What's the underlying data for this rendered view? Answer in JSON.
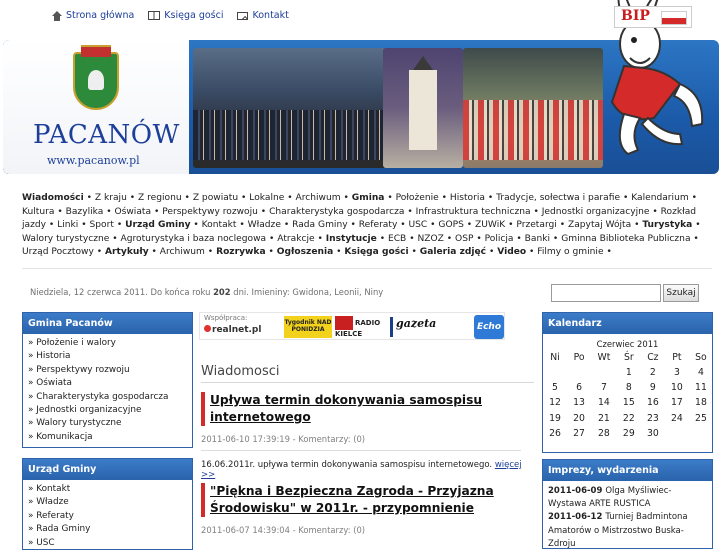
{
  "topnav": {
    "home": "Strona główna",
    "guestbook": "Księga gości",
    "contact": "Kontakt"
  },
  "brand": {
    "title": "PACANÓW",
    "url": "www.pacanow.pl",
    "bip_logo": "BIP"
  },
  "nav": [
    {
      "label": "Wiadomości",
      "bold": true
    },
    {
      "label": "Z kraju",
      "bold": false
    },
    {
      "label": "Z regionu",
      "bold": false
    },
    {
      "label": "Z powiatu",
      "bold": false
    },
    {
      "label": "Lokalne",
      "bold": false
    },
    {
      "label": "Archiwum",
      "bold": false
    },
    {
      "label": "Gmina",
      "bold": true
    },
    {
      "label": "Położenie",
      "bold": false
    },
    {
      "label": "Historia",
      "bold": false
    },
    {
      "label": "Tradycje, sołectwa i parafie",
      "bold": false
    },
    {
      "label": "Kalendarium",
      "bold": false
    },
    {
      "label": "Kultura",
      "bold": false
    },
    {
      "label": "Bazylika",
      "bold": false
    },
    {
      "label": "Oświata",
      "bold": false
    },
    {
      "label": "Perspektywy rozwoju",
      "bold": false
    },
    {
      "label": "Charakterystyka gospodarcza",
      "bold": false
    },
    {
      "label": "Infrastruktura techniczna",
      "bold": false
    },
    {
      "label": "Jednostki organizacyjne",
      "bold": false
    },
    {
      "label": "Rozkład jazdy",
      "bold": false
    },
    {
      "label": "Linki",
      "bold": false
    },
    {
      "label": "Sport",
      "bold": false
    },
    {
      "label": "Urząd Gminy",
      "bold": true
    },
    {
      "label": "Kontakt",
      "bold": false
    },
    {
      "label": "Władze",
      "bold": false
    },
    {
      "label": "Rada Gminy",
      "bold": false
    },
    {
      "label": "Referaty",
      "bold": false
    },
    {
      "label": "USC",
      "bold": false
    },
    {
      "label": "GOPS",
      "bold": false
    },
    {
      "label": "ZUWiK",
      "bold": false
    },
    {
      "label": "Przetargi",
      "bold": false
    },
    {
      "label": "Zapytaj Wójta",
      "bold": false
    },
    {
      "label": "Turystyka",
      "bold": true
    },
    {
      "label": "Walory turystyczne",
      "bold": false
    },
    {
      "label": "Agroturystyka i baza noclegowa",
      "bold": false
    },
    {
      "label": "Atrakcje",
      "bold": false
    },
    {
      "label": "Instytucje",
      "bold": true
    },
    {
      "label": "ECB",
      "bold": false
    },
    {
      "label": "NZOZ",
      "bold": false
    },
    {
      "label": "OSP",
      "bold": false
    },
    {
      "label": "Policja",
      "bold": false
    },
    {
      "label": "Banki",
      "bold": false
    },
    {
      "label": "Gminna Biblioteka Publiczna",
      "bold": false
    },
    {
      "label": "Urząd Pocztowy",
      "bold": false
    },
    {
      "label": "Artykuły",
      "bold": true
    },
    {
      "label": "Archiwum",
      "bold": false
    },
    {
      "label": "Rozrywka",
      "bold": true
    },
    {
      "label": "Ogłoszenia",
      "bold": true
    },
    {
      "label": "Księga gości",
      "bold": true
    },
    {
      "label": "Galeria zdjęć",
      "bold": true
    },
    {
      "label": "Video",
      "bold": true
    },
    {
      "label": "Filmy o gminie",
      "bold": false
    }
  ],
  "dateline": {
    "prefix": "Niedziela, 12 czerwca 2011. Do końca roku",
    "days": "202",
    "suffix": "dni. Imieniny:",
    "names": "Gwidona, Leonii, Niny"
  },
  "search": {
    "placeholder": "",
    "button": "Szukaj"
  },
  "sidebar_gmina": {
    "title": "Gmina Pacanów",
    "items": [
      "» Położenie i walory",
      "» Historia",
      "» Perspektywy rozwoju",
      "» Oświata",
      "» Charakterystyka gospodarcza",
      "» Jednostki organizacyjne",
      "» Walory turystyczne",
      "» Komunikacja"
    ]
  },
  "sidebar_urzad": {
    "title": "Urząd Gminy",
    "items": [
      "» Kontakt",
      "» Władze",
      "» Referaty",
      "» Rada Gminy",
      "» USC"
    ]
  },
  "partners": {
    "label": "Współpraca:",
    "logos": [
      "realnet.pl",
      "Tygodnik NAD PONIDZIA",
      "RADIO KIELCE",
      "gazeta",
      "Echo dnia"
    ]
  },
  "main": {
    "heading": "Wiadomosci",
    "articles": [
      {
        "title": "Upływa termin dokonywania samospisu internetowego",
        "meta": "2011-06-10 17:39:19 - Komentarzy: (0)",
        "body": "16.06.2011r. upływa termin dokonywania samospisu internetowego.",
        "more": "więcej >>"
      },
      {
        "title": "\"Piękna i Bezpieczna Zagroda - Przyjazna Środowisku\" w 2011r. - przypomnienie",
        "meta": "2011-06-07 14:39:04 - Komentarzy: (0)",
        "body": "",
        "more": ""
      }
    ]
  },
  "calendar": {
    "title": "Kalendarz",
    "month": "Czerwiec 2011",
    "weekdays": [
      "Ni",
      "Po",
      "Wt",
      "Śr",
      "Cz",
      "Pt",
      "So"
    ],
    "weeks": [
      [
        "",
        "",
        "",
        "1",
        "2",
        "3",
        "4"
      ],
      [
        "5",
        "6",
        "7",
        "8",
        "9",
        "10",
        "11"
      ],
      [
        "12",
        "13",
        "14",
        "15",
        "16",
        "17",
        "18"
      ],
      [
        "19",
        "20",
        "21",
        "22",
        "23",
        "24",
        "25"
      ],
      [
        "26",
        "27",
        "28",
        "29",
        "30",
        "",
        ""
      ]
    ]
  },
  "events": {
    "title": "Imprezy, wydarzenia",
    "items": [
      {
        "date": "2011-06-09",
        "text": "Olga Myśliwiec- Wystawa ARTE RUSTICA"
      },
      {
        "date": "2011-06-12",
        "text": "Turniej Badmintona Amatorów o Mistrzostwo Buska-Zdroju"
      }
    ]
  },
  "colors": {
    "accent_blue": "#2a63ac",
    "link_blue": "#1d3f9a",
    "title_red_bar": "#d42a2a"
  }
}
